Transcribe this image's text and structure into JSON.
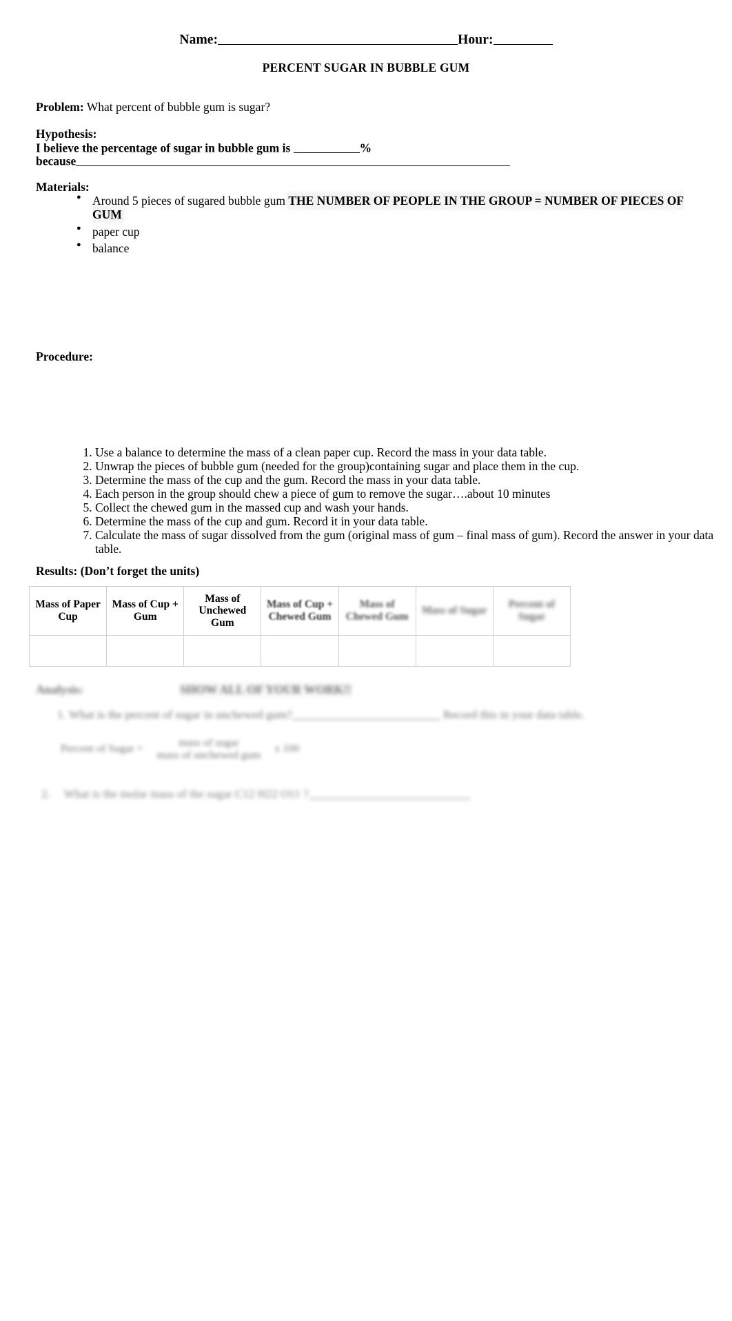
{
  "header": {
    "name_label": "Name:",
    "hour_label": "Hour:",
    "title": "PERCENT SUGAR IN BUBBLE GUM"
  },
  "problem": {
    "label": "Problem:",
    "text": "What percent of bubble gum is sugar?"
  },
  "hypothesis": {
    "label": "Hypothesis:",
    "line1_pre": "I believe the percentage of sugar in bubble gum is ",
    "line1_post": "%",
    "line2": "because"
  },
  "materials": {
    "label": "Materials:",
    "items": [
      {
        "plain": "Around 5 pieces of sugared bubble gum ",
        "emphasis": "THE NUMBER OF PEOPLE IN THE GROUP = NUMBER OF PIECES OF GUM"
      },
      {
        "plain": "paper cup",
        "emphasis": ""
      },
      {
        "plain": "balance",
        "emphasis": ""
      }
    ]
  },
  "procedure": {
    "label": "Procedure:",
    "steps": [
      "Use a balance to determine the mass of a clean paper cup.  Record the mass in your data table.",
      "Unwrap the pieces of bubble gum (needed for the group)containing sugar and place them in the cup.",
      "Determine the mass of the cup and the gum.  Record the mass in your data table.",
      "Each person in the group should chew a piece of gum to remove the sugar….about 10 minutes",
      "Collect the chewed gum in the massed cup and wash your hands.",
      "Determine the mass of the cup and gum.  Record it in your data table.",
      "Calculate the mass of sugar dissolved from the gum (original mass of gum – final mass of gum).  Record the answer in your data table."
    ]
  },
  "results": {
    "label": "Results:  (Don’t forget the units)",
    "table": {
      "headers": [
        "Mass of Paper Cup",
        "Mass of Cup + Gum",
        "Mass of Unchewed Gum",
        "Mass of Cup + Chewed Gum",
        "Mass of Chewed Gum",
        "Mass of Sugar",
        "Percent of Sugar"
      ],
      "rows": [
        [
          "",
          "",
          "",
          "",
          "",
          "",
          ""
        ]
      ]
    }
  },
  "analysis": {
    "label": "Analysis:",
    "emphasis": "SHOW ALL OF YOUR WORK!!",
    "questions": [
      {
        "text": "What is the percent of sugar in unchewed gum?",
        "trailing": "Record this in your data table."
      },
      {
        "text": "What is the molar mass of the sugar C12 H22 O11 ?",
        "trailing": ""
      }
    ],
    "formula": {
      "label": "Percent of Sugar =",
      "numerator": "mass of sugar",
      "denominator": "mass of unchewed gum",
      "multiplier": "x 100"
    }
  }
}
